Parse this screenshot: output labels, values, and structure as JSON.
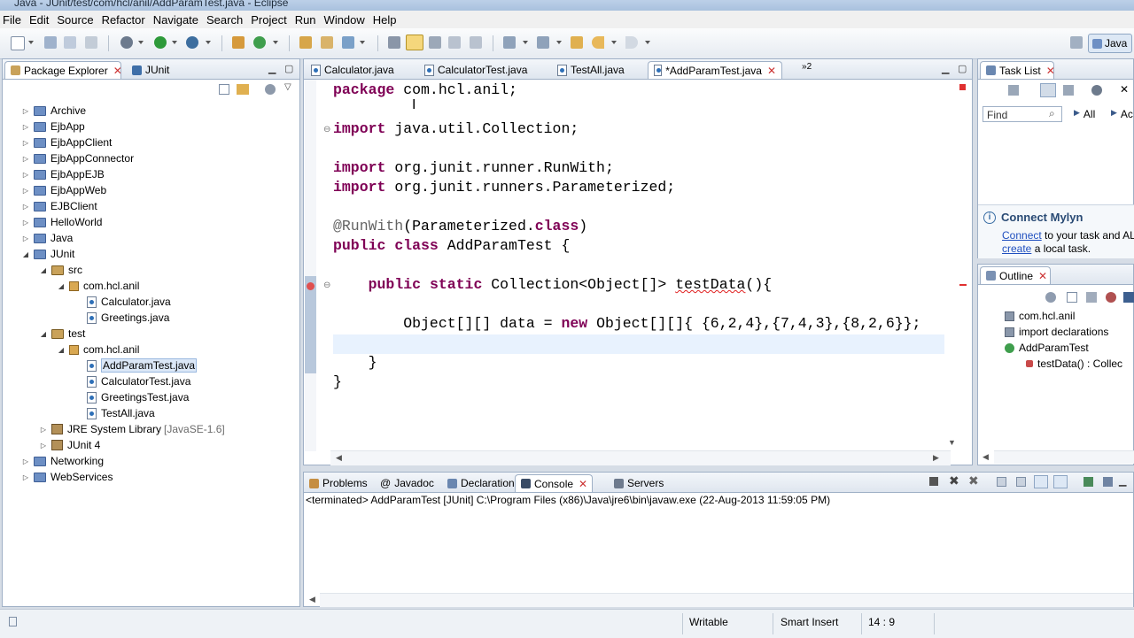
{
  "window": {
    "title": "Java - JUnit/test/com/hcl/anil/AddParamTest.java - Eclipse"
  },
  "menu": [
    "File",
    "Edit",
    "Source",
    "Refactor",
    "Navigate",
    "Search",
    "Project",
    "Run",
    "Window",
    "Help"
  ],
  "perspective": {
    "label": "Java"
  },
  "left_panel": {
    "tabs": [
      {
        "label": "Package Explorer",
        "active": true
      },
      {
        "label": "JUnit",
        "active": false
      }
    ],
    "tree": [
      {
        "label": "Archive",
        "type": "project",
        "depth": 0,
        "expanded": false
      },
      {
        "label": "EjbApp",
        "type": "project",
        "depth": 0,
        "expanded": false
      },
      {
        "label": "EjbAppClient",
        "type": "project",
        "depth": 0,
        "expanded": false
      },
      {
        "label": "EjbAppConnector",
        "type": "project",
        "depth": 0,
        "expanded": false
      },
      {
        "label": "EjbAppEJB",
        "type": "project",
        "depth": 0,
        "expanded": false
      },
      {
        "label": "EjbAppWeb",
        "type": "project",
        "depth": 0,
        "expanded": false
      },
      {
        "label": "EJBClient",
        "type": "project",
        "depth": 0,
        "expanded": false
      },
      {
        "label": "HelloWorld",
        "type": "project",
        "depth": 0,
        "expanded": false
      },
      {
        "label": "Java",
        "type": "project",
        "depth": 0,
        "expanded": false
      },
      {
        "label": "JUnit",
        "type": "project",
        "depth": 0,
        "expanded": true
      },
      {
        "label": "src",
        "type": "srcfolder",
        "depth": 1,
        "expanded": true
      },
      {
        "label": "com.hcl.anil",
        "type": "package",
        "depth": 2,
        "expanded": true
      },
      {
        "label": "Calculator.java",
        "type": "java",
        "depth": 3,
        "expanded": false
      },
      {
        "label": "Greetings.java",
        "type": "java",
        "depth": 3,
        "expanded": false
      },
      {
        "label": "test",
        "type": "srcfolder",
        "depth": 1,
        "expanded": true
      },
      {
        "label": "com.hcl.anil",
        "type": "package",
        "depth": 2,
        "expanded": true
      },
      {
        "label": "AddParamTest.java",
        "type": "java",
        "depth": 3,
        "expanded": false,
        "selected": true
      },
      {
        "label": "CalculatorTest.java",
        "type": "java",
        "depth": 3,
        "expanded": false
      },
      {
        "label": "GreetingsTest.java",
        "type": "java",
        "depth": 3,
        "expanded": false
      },
      {
        "label": "TestAll.java",
        "type": "java",
        "depth": 3,
        "expanded": false
      },
      {
        "label": "JRE System Library",
        "suffix": "[JavaSE-1.6]",
        "type": "library",
        "depth": 1,
        "expanded": false
      },
      {
        "label": "JUnit 4",
        "type": "library",
        "depth": 1,
        "expanded": false
      },
      {
        "label": "Networking",
        "type": "project",
        "depth": 0,
        "expanded": false
      },
      {
        "label": "WebServices",
        "type": "project",
        "depth": 0,
        "expanded": false
      }
    ]
  },
  "editor": {
    "tabs": [
      {
        "label": "Calculator.java",
        "active": false
      },
      {
        "label": "CalculatorTest.java",
        "active": false
      },
      {
        "label": "TestAll.java",
        "active": false
      },
      {
        "label": "*AddParamTest.java",
        "active": true
      }
    ],
    "overflow_count": "2",
    "lines": [
      "package com.hcl.anil;",
      "",
      "import java.util.Collection;",
      "",
      "import org.junit.runner.RunWith;",
      "import org.junit.runners.Parameterized;",
      "",
      "@RunWith(Parameterized.class)",
      "public class AddParamTest {",
      "",
      "    public static Collection<Object[]> testData(){",
      "",
      "        Object[][] data = new Object[][]{ {6,2,4},{7,4,3},{8,2,6}};",
      "",
      "    }",
      "}"
    ]
  },
  "task_list": {
    "tab": "Task List",
    "find_placeholder": "Find",
    "filter_all": "All",
    "filter_ac": "Ac",
    "mylyn_title": "Connect Mylyn",
    "mylyn_link1": "Connect",
    "mylyn_text1": " to your task and AL",
    "mylyn_link2": "create",
    "mylyn_text2": " a local task."
  },
  "outline": {
    "tab": "Outline",
    "items": [
      {
        "label": "com.hcl.anil",
        "depth": 0
      },
      {
        "label": "import declarations",
        "depth": 0
      },
      {
        "label": "AddParamTest",
        "depth": 0
      },
      {
        "label": "testData() : Collec",
        "depth": 1
      }
    ]
  },
  "bottom_panel": {
    "tabs": [
      {
        "label": "Problems",
        "active": false
      },
      {
        "label": "Javadoc",
        "active": false
      },
      {
        "label": "Declaration",
        "active": false
      },
      {
        "label": "Console",
        "active": true
      },
      {
        "label": "Servers",
        "active": false
      }
    ],
    "console_status": "<terminated> AddParamTest [JUnit] C:\\Program Files (x86)\\Java\\jre6\\bin\\javaw.exe (22-Aug-2013 11:59:05 PM)"
  },
  "status": {
    "writable": "Writable",
    "insert_mode": "Smart Insert",
    "position": "14 : 9"
  },
  "colors": {
    "keyword": "#7f0055",
    "annotation": "#646464",
    "error": "#e02020",
    "current_line": "#e8f2fe",
    "selection": "#dbe7f7"
  }
}
